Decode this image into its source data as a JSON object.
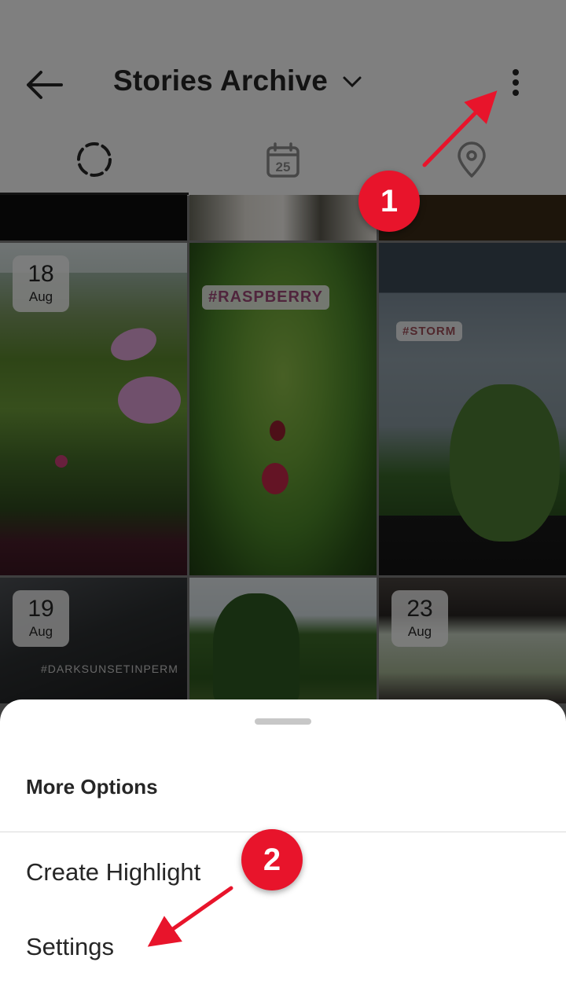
{
  "header": {
    "title": "Stories Archive",
    "back_icon": "arrow-left-icon",
    "title_dropdown_icon": "chevron-down-icon",
    "more_icon": "more-vertical-icon"
  },
  "tabs": [
    {
      "name": "archive",
      "icon": "circle-dashed-icon",
      "active": true
    },
    {
      "name": "calendar",
      "icon": "calendar-icon",
      "label": "25",
      "active": false
    },
    {
      "name": "map",
      "icon": "location-pin-icon",
      "active": false
    }
  ],
  "grid": {
    "tiles": [
      {
        "id": "top-left"
      },
      {
        "id": "top-middle"
      },
      {
        "id": "top-right"
      },
      {
        "day": "18",
        "month": "Aug"
      },
      {
        "tag": "#RASPBERRY"
      },
      {
        "tag": "#STORM"
      },
      {
        "day": "19",
        "month": "Aug",
        "tag": "#DARKSUNSETINPERM"
      },
      {
        "id": "tree"
      },
      {
        "day": "23",
        "month": "Aug"
      }
    ]
  },
  "sheet": {
    "title": "More Options",
    "items": [
      "Create Highlight",
      "Settings"
    ]
  },
  "annotations": {
    "marker1": "1",
    "marker2": "2",
    "color": "#e8142b"
  }
}
